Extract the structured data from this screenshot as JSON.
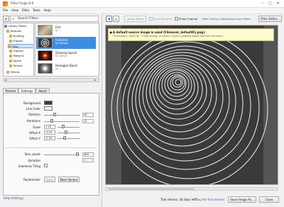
{
  "window": {
    "title": "Filter Forge 6.0"
  },
  "menu": [
    "File",
    "View",
    "Filter",
    "Tools",
    "Help"
  ],
  "library": {
    "search_label": "Search Filters",
    "tree": [
      {
        "label": "Library Filters"
      },
      {
        "label": "Textures"
      },
      {
        "label": "Building"
      },
      {
        "label": "Frames"
      },
      {
        "label": "Misc"
      },
      {
        "label": "Organic"
      },
      {
        "label": "Patterns"
      },
      {
        "label": "Space"
      },
      {
        "label": "Techno"
      },
      {
        "label": "Effects"
      }
    ],
    "filters": [
      {
        "name": "Fall",
        "sub": "by ..."
      },
      {
        "name": "Hellofish",
        "sub": "by Skybase"
      },
      {
        "name": "Glowing Spiral",
        "sub": "by Sphinx"
      },
      {
        "name": "Hexagon Band",
        "sub": "by ..."
      }
    ]
  },
  "tabs": [
    "Presets",
    "Settings",
    "About"
  ],
  "settings": {
    "background_label": "Background",
    "line_color_label": "Line Color",
    "rotation_label": "Rotation",
    "rotation_value": "30",
    "iterations_label": "Iterations",
    "iterations_value": "10",
    "scale_label": "Scale",
    "scale_value": "1.13",
    "offset_x_label": "Offset X",
    "offset_x_value": "-0.19",
    "offset_y_label": "Offset Y",
    "offset_y_value": "-0.24",
    "size_label": "Size, pixels",
    "size_value": "480",
    "variation_label": "Variation",
    "variation_value": "1",
    "seamless_label": "Seamless Tiling",
    "randomizer_label": "Randomizer",
    "back_label": "Back",
    "next_variant_label": "Next Variant",
    "colors": {
      "background": "#3a3a3a",
      "line": "#f2f2f2"
    }
  },
  "help_link": "Help Settings",
  "toolbar": {
    "actual_pixels": "Actual Pixels",
    "show_borders": "Show Borders",
    "show_original": "Show Original",
    "download_link": "Filter Library: Download more filters",
    "filter_editor": "Filter Editor..."
  },
  "notice": {
    "line1": "A default source image is used (Filesaver_default01.png).",
    "line2": "To change it, click File → Open Image, or select a built-in preview image from the File menu."
  },
  "status": {
    "trial": "Trial version, 30 days left.",
    "buy_link": "Buy the full version!",
    "save_label": "Save Image As...",
    "close_label": "Close"
  }
}
